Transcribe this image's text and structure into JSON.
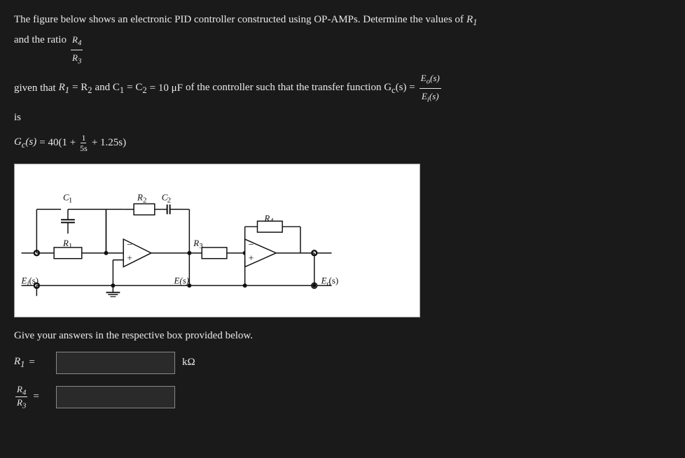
{
  "problem": {
    "intro": "The figure below shows an electronic PID controller constructed using OP-AMPs. Determine the values of ",
    "r1_label": "R",
    "r1_sub": "1",
    "and_ratio": "and the ratio",
    "ratio_numer": "R",
    "ratio_numer_sub": "4",
    "ratio_denom": "R",
    "ratio_denom_sub": "3",
    "given_intro": "given that ",
    "given_eq1": "R",
    "given_eq1_sub": "1",
    "given_eq1_mid": " = R",
    "given_eq1_mid2": "2",
    "given_and": " and C",
    "given_c1_sub": "1",
    "given_eq2": " = C",
    "given_c2_sub": "2",
    "given_val": " = 10 μF",
    "given_tf_intro": "of the controller such that the transfer function G",
    "given_tf_sub": "c",
    "given_tf_s": "(s) =",
    "tf_numer": "E",
    "tf_numer_sub": "o",
    "tf_numer_s": "(s)",
    "tf_denom": "E",
    "tf_denom_sub": "i",
    "tf_denom_s": "(s)",
    "is_label": "is",
    "gc_eq": "G",
    "gc_sub": "c",
    "gc_s": "(s) = 40(1 +",
    "gc_frac_numer": "1",
    "gc_frac_denom": "5s",
    "gc_rest": "+ 1.25s)",
    "instruction": "Give your answers in the respective box provided below.",
    "r1_answer_label": "R",
    "r1_answer_sub": "1",
    "r1_equals": "=",
    "r1_unit": "kΩ",
    "r1_placeholder": "",
    "ratio_answer_numer": "R",
    "ratio_answer_numer_sub": "4",
    "ratio_answer_denom": "R",
    "ratio_answer_denom_sub": "3",
    "ratio_equals": "=",
    "ratio_placeholder": ""
  },
  "circuit": {
    "labels": {
      "C1": "C₁",
      "R1": "R₁",
      "R2": "R₂",
      "C2": "C₂",
      "R3": "R₃",
      "R4": "R₄",
      "Ei_s": "Eᵢ(s)",
      "E_s": "E(s)",
      "Eo_s": "Eₒ(s)"
    }
  }
}
